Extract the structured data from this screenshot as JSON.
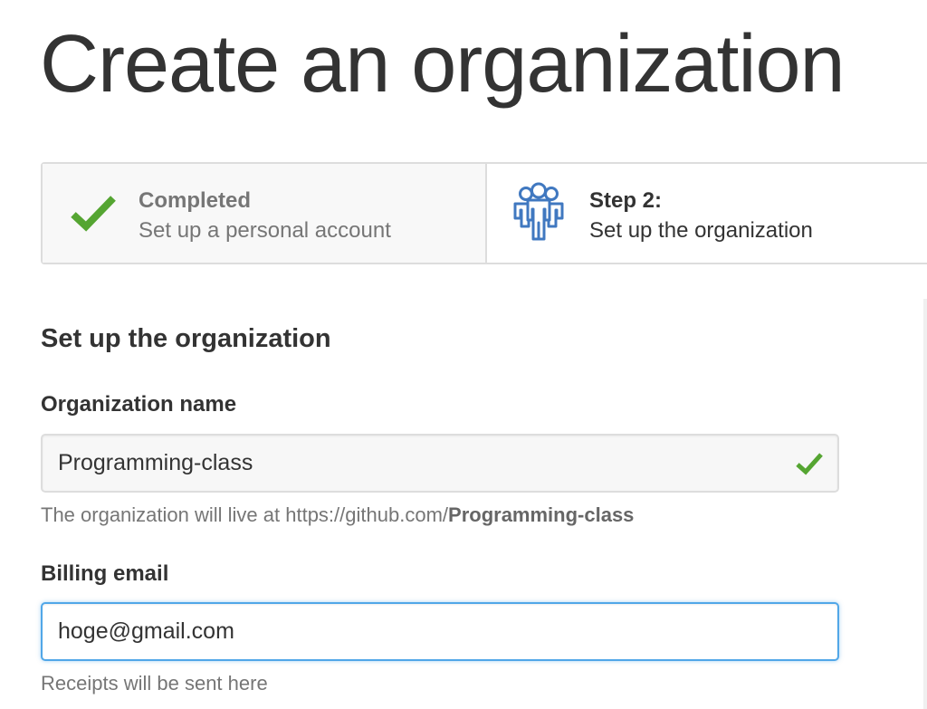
{
  "page": {
    "title": "Create an organization"
  },
  "steps": [
    {
      "state": "completed",
      "label": "Completed",
      "description": "Set up a personal account",
      "icon": "check-icon"
    },
    {
      "state": "current",
      "label": "Step 2:",
      "description": "Set up the organization",
      "icon": "organization-icon"
    }
  ],
  "form": {
    "section_title": "Set up the organization",
    "org_name": {
      "label": "Organization name",
      "value": "Programming-class",
      "status_icon": "check-icon",
      "note_prefix": "The organization will live at https://github.com/",
      "note_slug": "Programming-class"
    },
    "billing_email": {
      "label": "Billing email",
      "value": "hoge@gmail.com",
      "note": "Receipts will be sent here"
    }
  },
  "colors": {
    "success": "#55a532",
    "accent": "#4078c0",
    "focus": "#51a7e8",
    "text": "#333333",
    "muted": "#767676"
  }
}
